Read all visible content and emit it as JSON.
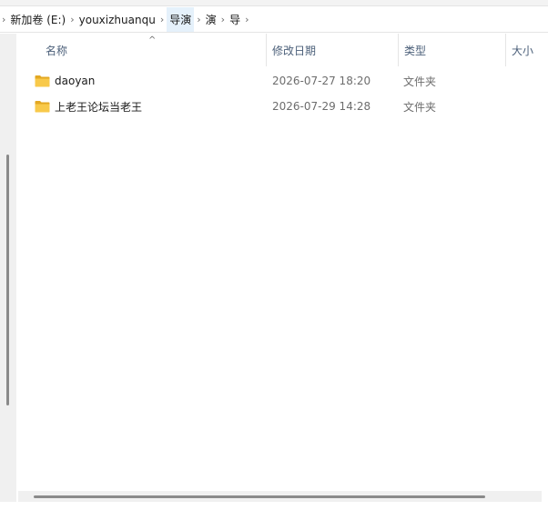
{
  "breadcrumb": {
    "items": [
      {
        "label": "新加卷 (E:)",
        "active": false
      },
      {
        "label": "youxizhuanqu",
        "active": false
      },
      {
        "label": "导演",
        "active": true
      },
      {
        "label": "演",
        "active": false
      },
      {
        "label": "导",
        "active": false
      }
    ],
    "separator": "›"
  },
  "columns": {
    "name": "名称",
    "date_modified": "修改日期",
    "type": "类型",
    "size": "大小",
    "sort_indicator": "^"
  },
  "files": [
    {
      "name": "daoyan",
      "date_modified": "2026-07-27 18:20",
      "type": "文件夹",
      "icon": "folder-icon"
    },
    {
      "name": "上老王论坛当老王",
      "date_modified": "2026-07-29 14:28",
      "type": "文件夹",
      "icon": "folder-icon"
    }
  ],
  "colors": {
    "folder_yellow": "#f8c94a",
    "folder_dark": "#e3a823",
    "header_text": "#4c607a",
    "active_crumb_bg": "#e5f1fb",
    "scrollbar_thumb": "#8a8a8a"
  }
}
